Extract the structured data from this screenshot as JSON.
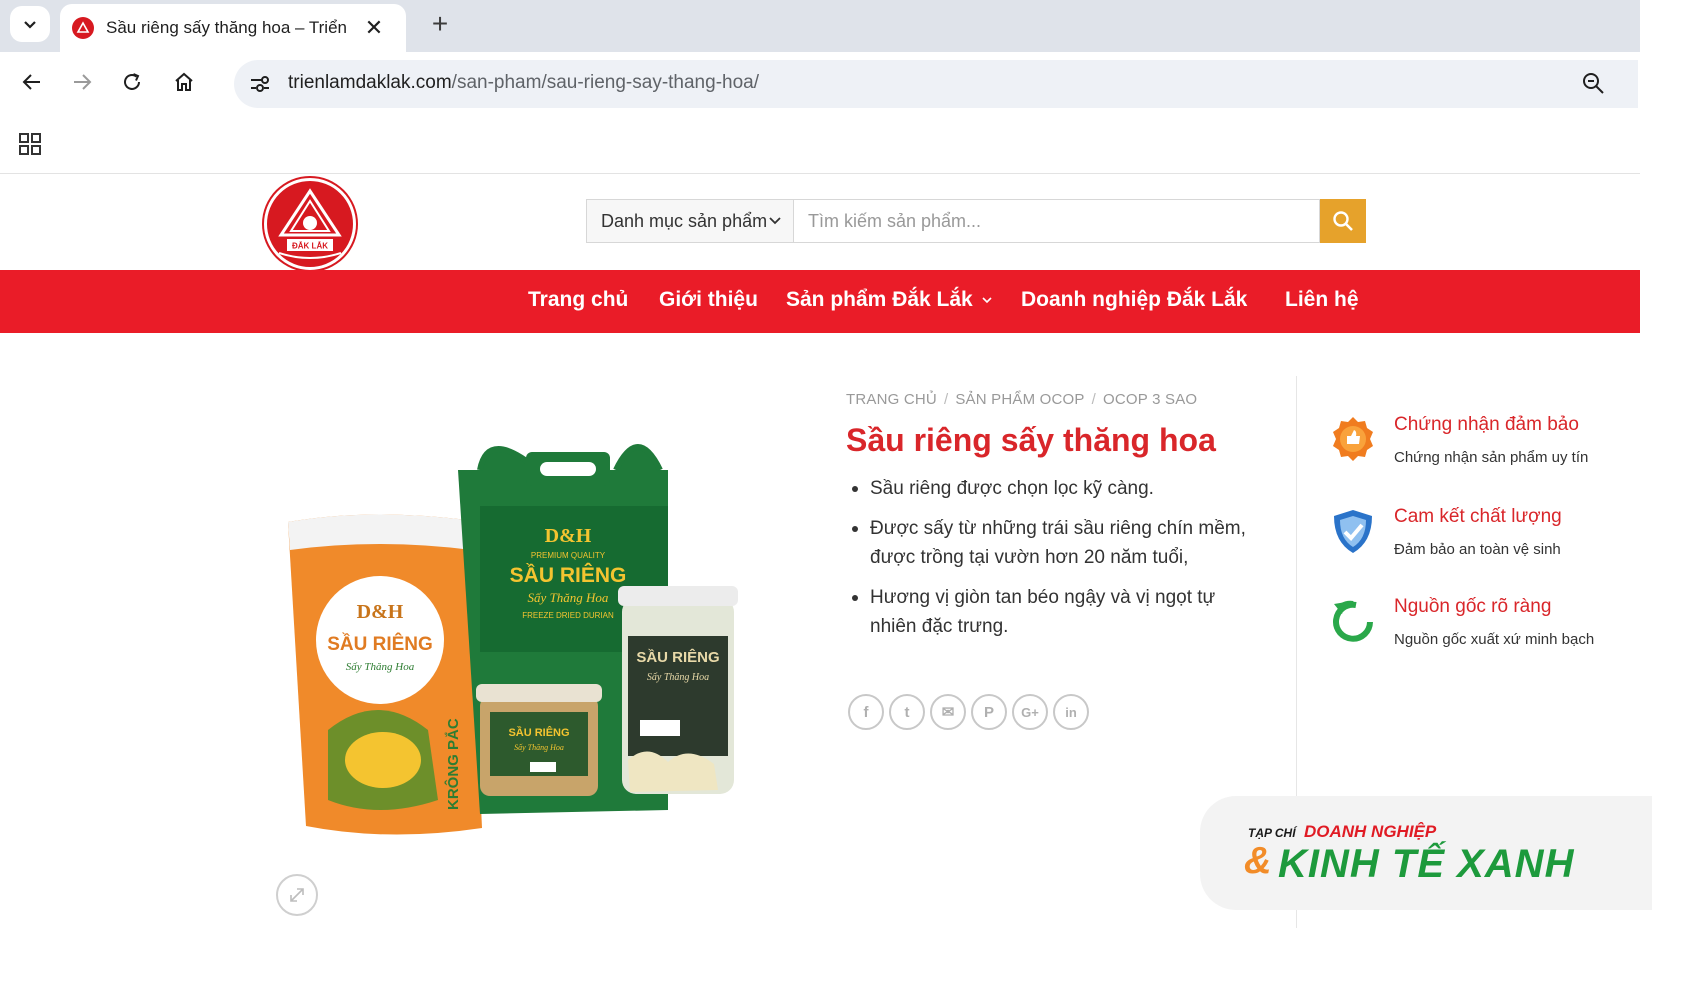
{
  "browser": {
    "tab": {
      "title": "Sầu riêng sấy thăng hoa – Triển",
      "close": "✕"
    },
    "new_tab": "+",
    "url": {
      "domain": "trienlamdaklak.com",
      "path": "/san-pham/sau-rieng-say-thang-hoa/"
    }
  },
  "header": {
    "logo_text": "ĐẮK LẮK",
    "category": "Danh mục sản phẩm",
    "search_placeholder": "Tìm kiếm sản phẩm..."
  },
  "nav": {
    "items": [
      "Trang chủ",
      "Giới thiệu",
      "Sản phẩm Đắk Lắk",
      "Doanh nghiệp Đắk Lắk",
      "Liên hệ"
    ]
  },
  "product": {
    "breadcrumb": [
      "TRANG CHỦ",
      "SẢN PHẨM OCOP",
      "OCOP 3 SAO"
    ],
    "breadcrumb_sep": "/",
    "title": "Sầu riêng sấy thăng hoa",
    "features": [
      "Sầu riêng được chọn lọc kỹ càng.",
      "Được sấy từ những trái sầu riêng chín mềm, được trồng tại vườn hơn 20 năm tuổi,",
      "Hương vị giòn tan béo ngậy và vị ngọt tự nhiên đặc trưng."
    ],
    "image_texts": {
      "brand": "D&H",
      "name": "SẦU RIÊNG",
      "sub": "Sấy Thăng Hoa",
      "en": "FREEZE DRIED DURIAN",
      "premium": "PREMIUM QUALITY",
      "side": "KRÔNG PẮC"
    },
    "share_icons": [
      "facebook-icon",
      "twitter-icon",
      "email-icon",
      "pinterest-icon",
      "googleplus-icon",
      "linkedin-icon"
    ],
    "share_glyphs": [
      "f",
      "t",
      "✉",
      "P",
      "G+",
      "in"
    ]
  },
  "benefits": [
    {
      "title": "Chứng nhận đảm bảo",
      "desc": "Chứng nhận sản phẩm uy tín",
      "icon": "award-icon",
      "color": "#f07c1f"
    },
    {
      "title": "Cam kết chất lượng",
      "desc": "Đảm bảo an toàn vệ sinh",
      "icon": "shield-icon",
      "color": "#2a73c9"
    },
    {
      "title": "Nguồn gốc rõ ràng",
      "desc": "Nguồn gốc xuất xứ minh bạch",
      "icon": "refresh-icon",
      "color": "#2aa84a"
    }
  ],
  "watermark": {
    "prefix": "TẠP CHÍ",
    "line1": "DOANH NGHIỆP",
    "amp": "&",
    "line2": "KINH TẾ XANH"
  },
  "colors": {
    "nav_red": "#ea1c28",
    "title_red": "#d9262a",
    "search_orange": "#e6a22b"
  }
}
